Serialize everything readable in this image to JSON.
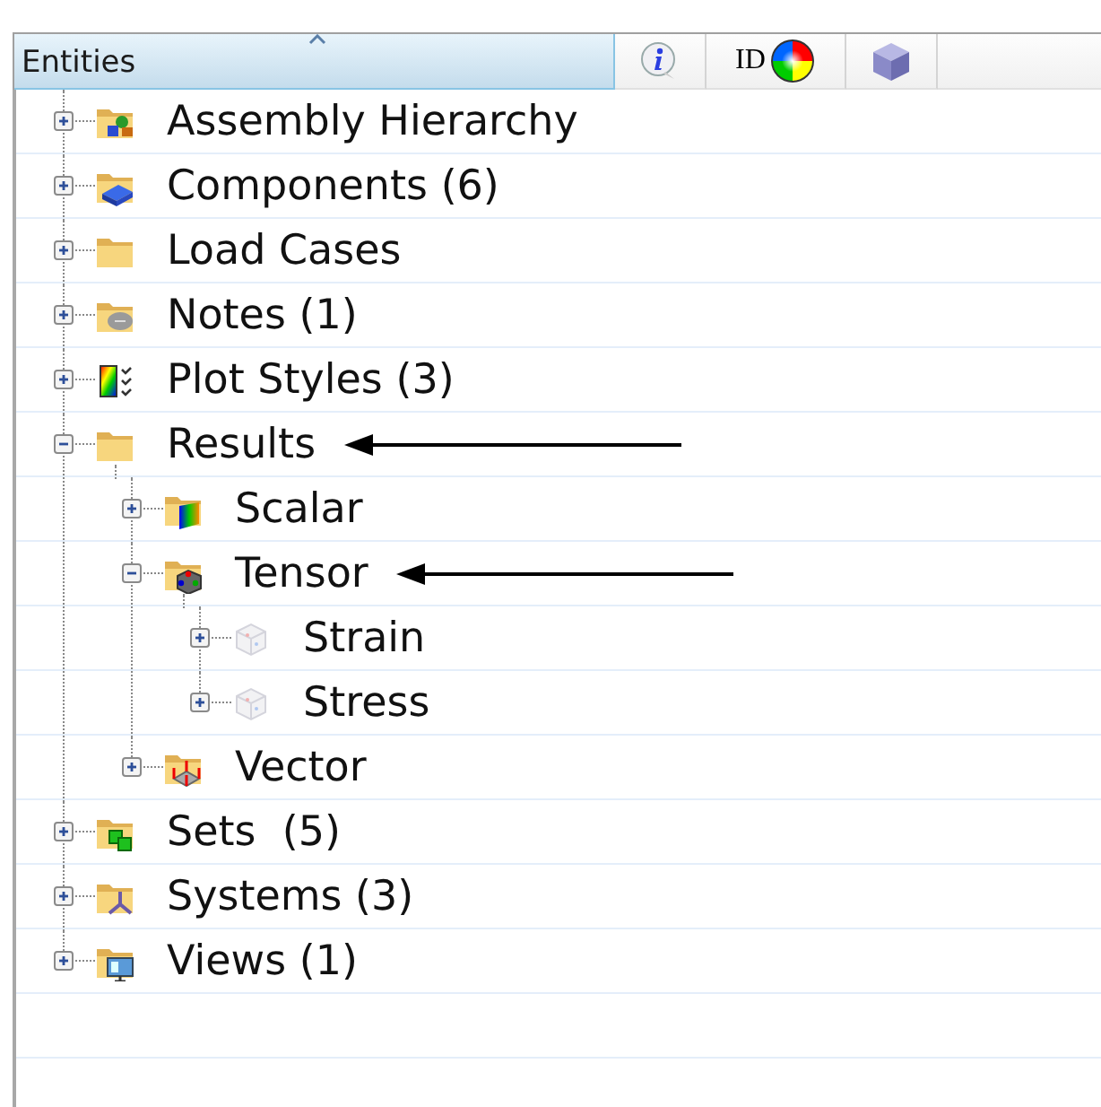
{
  "header": {
    "title": "Entities",
    "id_label": "ID"
  },
  "tree": [
    {
      "label": "Assembly Hierarchy",
      "kind": "assembly",
      "expanded": false,
      "arrow": false
    },
    {
      "label": "Components (6)",
      "kind": "components",
      "expanded": false,
      "arrow": false
    },
    {
      "label": "Load Cases",
      "kind": "folder",
      "expanded": false,
      "arrow": false
    },
    {
      "label": "Notes (1)",
      "kind": "notes",
      "expanded": false,
      "arrow": false
    },
    {
      "label": "Plot Styles (3)",
      "kind": "plotstyles",
      "expanded": false,
      "arrow": false
    },
    {
      "label": "Results",
      "kind": "folder",
      "expanded": true,
      "arrow": true,
      "children": [
        {
          "label": "Scalar",
          "kind": "scalar",
          "expanded": false,
          "arrow": false
        },
        {
          "label": "Tensor",
          "kind": "tensor",
          "expanded": true,
          "arrow": true,
          "children": [
            {
              "label": "Strain",
              "kind": "tensor-faded",
              "expanded": false,
              "arrow": false
            },
            {
              "label": "Stress",
              "kind": "tensor-faded",
              "expanded": false,
              "arrow": false
            }
          ]
        },
        {
          "label": "Vector",
          "kind": "vector",
          "expanded": false,
          "arrow": false
        }
      ]
    },
    {
      "label": "Sets  (5)",
      "kind": "sets",
      "expanded": false,
      "arrow": false
    },
    {
      "label": "Systems (3)",
      "kind": "systems",
      "expanded": false,
      "arrow": false
    },
    {
      "label": "Views (1)",
      "kind": "views",
      "expanded": false,
      "arrow": false
    }
  ]
}
